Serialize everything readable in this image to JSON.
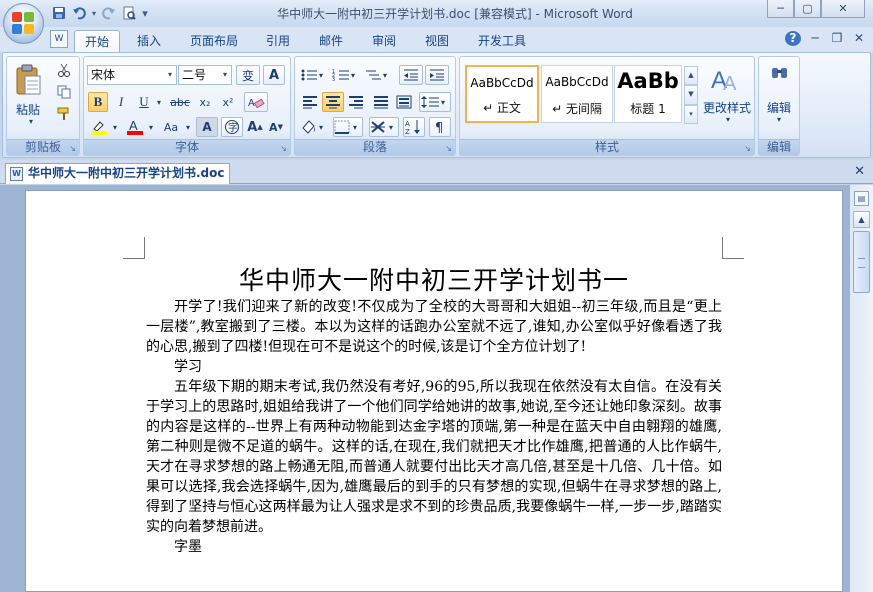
{
  "window": {
    "title": "华中师大一附中初三开学计划书.doc [兼容模式] - Microsoft Word",
    "controls": {
      "minimize": "─",
      "maximize": "▢",
      "close": "✕"
    }
  },
  "quick_access": {
    "save_icon": "save-icon",
    "undo_icon": "undo-icon",
    "redo_icon": "redo-icon",
    "preview_icon": "print-preview-icon",
    "customize": "▾"
  },
  "tabs": [
    "开始",
    "插入",
    "页面布局",
    "引用",
    "邮件",
    "审阅",
    "视图",
    "开发工具"
  ],
  "active_tab": "开始",
  "tab_right": {
    "help": "?",
    "minimize": "─",
    "restore": "❐",
    "close": "✕"
  },
  "ribbon": {
    "clipboard": {
      "label": "剪贴板",
      "paste": "粘贴"
    },
    "font": {
      "label": "字体",
      "font_name": "宋体",
      "font_size": "二号",
      "wen": "变",
      "A_box": "A",
      "bold": "B",
      "italic": "I",
      "underline": "U",
      "strike": "abc",
      "sub": "x₂",
      "sup": "x²",
      "aa": "Aa",
      "grow": "A",
      "shrink": "A"
    },
    "paragraph": {
      "label": "段落"
    },
    "styles": {
      "label": "样式",
      "items": [
        {
          "sample": "AaBbCcDd",
          "name": "↵ 正文"
        },
        {
          "sample": "AaBbCcDd",
          "name": "↵ 无间隔"
        },
        {
          "sample": "AaBb",
          "name": "标题 1"
        }
      ],
      "change_styles": "更改样式"
    },
    "editing": {
      "label": "编辑"
    }
  },
  "document_tab": {
    "name": "华中师大一附中初三开学计划书.doc",
    "close": "✕"
  },
  "document": {
    "title": "华中师大一附中初三开学计划书一",
    "paragraphs": [
      {
        "text": "开学了!我们迎来了新的改变!不仅成为了全校的大哥哥和大姐姐--初三年级,而且是“更上一层楼”,教室搬到了三楼。本以为这样的话跑办公室就不远了,谁知,办公室似乎好像看透了我的心思,搬到了四楼!但现在可不是说这个的时候,该是订个全方位计划了!",
        "indent": true
      },
      {
        "text": "学习",
        "indent": true
      },
      {
        "text": "五年级下期的期末考试,我仍然没有考好,96的95,所以我现在依然没有太自信。在没有关于学习上的思路时,姐姐给我讲了一个他们同学给她讲的故事,她说,至今还让她印象深刻。故事的内容是这样的--世界上有两种动物能到达金字塔的顶端,第一种是在蓝天中自由翱翔的雄鹰,第二种则是微不足道的蜗牛。这样的话,在现在,我们就把天才比作雄鹰,把普通的人比作蜗牛,天才在寻求梦想的路上畅通无阻,而普通人就要付出比天才高几倍,甚至是十几倍、几十倍。如果可以选择,我会选择蜗牛,因为,雄鹰最后的到手的只有梦想的实现,但蜗牛在寻求梦想的路上,得到了坚持与恒心这两样最为让人强求是求不到的珍贵品质,我要像蜗牛一样,一步一步,踏踏实实的向着梦想前进。",
        "indent": true
      },
      {
        "text": "字墨",
        "indent": true
      }
    ]
  },
  "colors": {
    "ribbon_text": "#15428b",
    "highlight": "#ffff00",
    "font_color": "#ff0000"
  }
}
